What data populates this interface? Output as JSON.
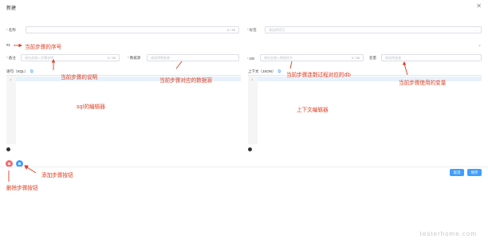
{
  "dialog": {
    "title": "新建",
    "close_icon": "close-icon"
  },
  "row1": {
    "name_label": "名称",
    "name_counter": "0 / 30",
    "tag_label": "标签",
    "tag_placeholder": "请选择项目"
  },
  "step": {
    "label": "#1"
  },
  "row2": {
    "remark_label": "备注",
    "remark_placeholder": "请在此输入步骤说明",
    "remark_counter": "0 / 30",
    "datasource_label": "数据源",
    "datasource_placeholder": "请选择数据源",
    "db_label": "DB",
    "db_placeholder": "请在此输入数据库名",
    "db_counter": "0 / 30",
    "variable_label": "变量",
    "variable_placeholder": "请选择变量"
  },
  "editors": {
    "sql_label": "语句（SQL）",
    "context_label": "上下文（JSON）",
    "sql_line_no": "1",
    "context_line_no": "1"
  },
  "footer": {
    "cancel_label": "取消",
    "save_label": "保存"
  },
  "annotations": {
    "step_number": "当前步骤的序号",
    "step_desc": "当前步骤的说明",
    "step_datasource": "当前步骤对应的数据源",
    "step_db": "当前步骤连数过程对应的db",
    "step_vars": "当前步骤使用的变量",
    "sql_editor": "sql的编辑器",
    "context_editor": "上下文编辑器",
    "add_step": "添加步骤按钮",
    "delete_step": "删除步骤按钮"
  },
  "watermark": "testerhome.com",
  "colors": {
    "accent": "#409eff",
    "annotation": "#e03c1e",
    "danger": "#f56c6c"
  }
}
